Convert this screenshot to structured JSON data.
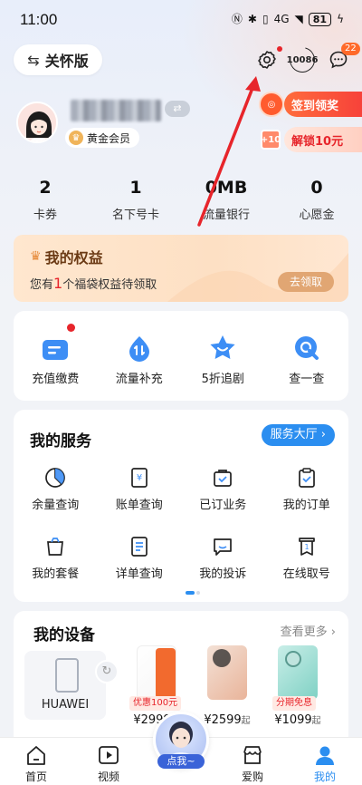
{
  "status_bar": {
    "time": "11:00",
    "network": "4G",
    "battery": "81"
  },
  "header": {
    "care_mode_label": "关怀版",
    "hotline_label": "10086",
    "message_badge": "22"
  },
  "profile": {
    "member_label": "黄金会员"
  },
  "promos": {
    "checkin_label": "签到领奖",
    "unlock_label": "解锁10元",
    "unlock_icon_text": "+10"
  },
  "stats": [
    {
      "value": "2",
      "label": "卡券"
    },
    {
      "value": "1",
      "label": "名下号卡"
    },
    {
      "value": "0MB",
      "label": "流量银行"
    },
    {
      "value": "0",
      "label": "心愿金"
    }
  ],
  "rights": {
    "title": "我的权益",
    "sub_before": "您有",
    "sub_count": "1",
    "sub_after": "个福袋权益待领取",
    "button": "去领取"
  },
  "quick_actions": [
    {
      "label": "充值缴费",
      "icon": "recharge-icon",
      "badge": true
    },
    {
      "label": "流量补充",
      "icon": "data-drop-icon",
      "badge": false
    },
    {
      "label": "5折追剧",
      "icon": "star-smile-icon",
      "badge": false
    },
    {
      "label": "查一查",
      "icon": "search-bubble-icon",
      "badge": false
    }
  ],
  "services": {
    "title": "我的服务",
    "hall_button": "服务大厅 ›",
    "items": [
      {
        "label": "余量查询",
        "icon": "pie-chart-icon"
      },
      {
        "label": "账单查询",
        "icon": "bill-yen-icon"
      },
      {
        "label": "已订业务",
        "icon": "subscribed-icon"
      },
      {
        "label": "我的订单",
        "icon": "order-clipboard-icon"
      },
      {
        "label": "我的套餐",
        "icon": "package-bag-icon"
      },
      {
        "label": "详单查询",
        "icon": "detail-list-icon"
      },
      {
        "label": "我的投诉",
        "icon": "complaint-icon"
      },
      {
        "label": "在线取号",
        "icon": "ticket-number-icon"
      }
    ]
  },
  "devices": {
    "title": "我的设备",
    "more": "查看更多 ›",
    "current_device": "HUAWEI",
    "products": [
      {
        "tag": "优惠100元",
        "price": "¥2999",
        "suffix": "起",
        "color": "#f26a2e"
      },
      {
        "tag": "",
        "price": "¥2599",
        "suffix": "起",
        "color": "#e9b49a"
      },
      {
        "tag": "分期免息",
        "price": "¥1099",
        "suffix": "起",
        "color": "#7fd1c4"
      }
    ]
  },
  "bottom_nav": {
    "items": [
      {
        "label": "首页"
      },
      {
        "label": "视频"
      },
      {
        "label": "爱购"
      },
      {
        "label": "我的"
      }
    ],
    "fab_label": "点我~"
  },
  "colors": {
    "accent": "#2b8ef0",
    "alert": "#e7252b",
    "orange": "#ff6a2a"
  }
}
